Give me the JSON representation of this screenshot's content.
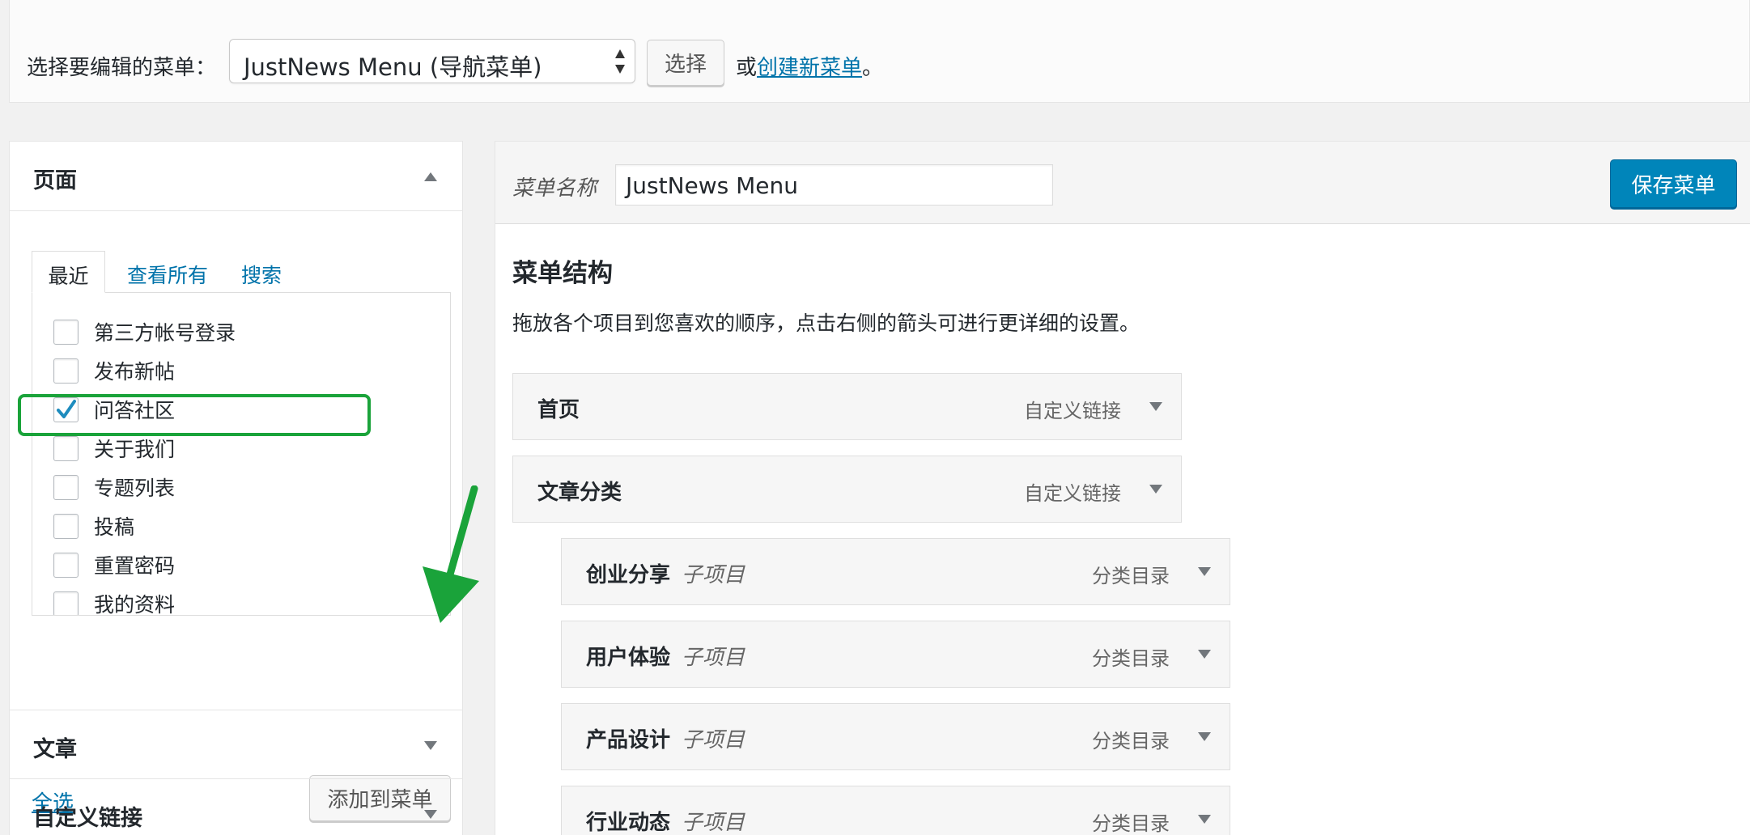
{
  "topbar": {
    "select_label": "选择要编辑的菜单：",
    "selected_menu": "JustNews Menu (导航菜单)",
    "select_button": "选择",
    "or_text": "或",
    "create_link": "创建新菜单",
    "period": "。"
  },
  "left": {
    "pages_title": "页面",
    "tabs": [
      "最近",
      "查看所有",
      "搜索"
    ],
    "pages": [
      {
        "label": "第三方帐号登录",
        "checked": false
      },
      {
        "label": "发布新帖",
        "checked": false
      },
      {
        "label": "问答社区",
        "checked": true
      },
      {
        "label": "关于我们",
        "checked": false
      },
      {
        "label": "专题列表",
        "checked": false
      },
      {
        "label": "投稿",
        "checked": false
      },
      {
        "label": "重置密码",
        "checked": false
      },
      {
        "label": "我的资料",
        "checked": false
      }
    ],
    "select_all": "全选",
    "add_button": "添加到菜单",
    "posts_title": "文章",
    "custom_links_title": "自定义链接"
  },
  "right": {
    "menu_name_label": "菜单名称",
    "menu_name_value": "JustNews Menu",
    "save_button": "保存菜单",
    "structure_title": "菜单结构",
    "structure_desc": "拖放各个项目到您喜欢的顺序，点击右侧的箭头可进行更详细的设置。",
    "items": [
      {
        "title": "首页",
        "sub": "",
        "type": "自定义链接",
        "depth": 0
      },
      {
        "title": "文章分类",
        "sub": "",
        "type": "自定义链接",
        "depth": 0
      },
      {
        "title": "创业分享",
        "sub": "子项目",
        "type": "分类目录",
        "depth": 1
      },
      {
        "title": "用户体验",
        "sub": "子项目",
        "type": "分类目录",
        "depth": 1
      },
      {
        "title": "产品设计",
        "sub": "子项目",
        "type": "分类目录",
        "depth": 1
      },
      {
        "title": "行业动态",
        "sub": "子项目",
        "type": "分类目录",
        "depth": 1
      }
    ]
  },
  "colors": {
    "link": "#0073aa",
    "primary_button": "#0085ba",
    "highlight": "#1aa33a",
    "check": "#1e8cbe"
  }
}
